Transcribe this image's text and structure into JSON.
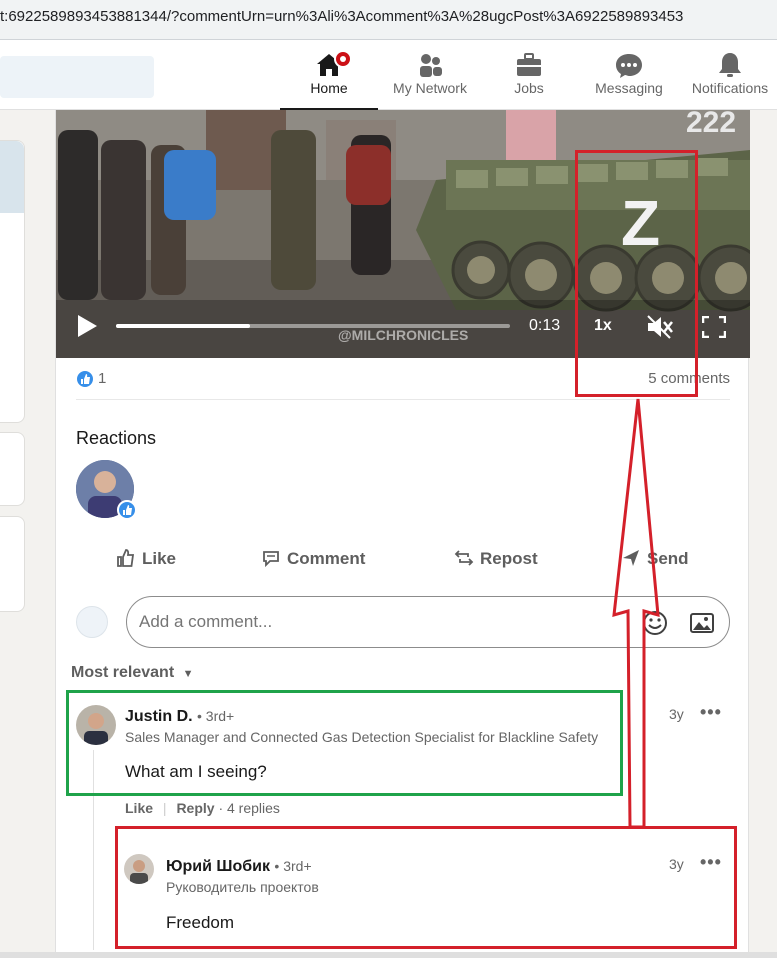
{
  "browser": {
    "url": "t:6922589893453881344/?commentUrn=urn%3Ali%3Acomment%3A%28ugcPost%3A6922589893453"
  },
  "nav": {
    "items": [
      {
        "label": "Home",
        "icon": "home-icon"
      },
      {
        "label": "My Network",
        "icon": "people-icon"
      },
      {
        "label": "Jobs",
        "icon": "briefcase-icon"
      },
      {
        "label": "Messaging",
        "icon": "chat-icon"
      },
      {
        "label": "Notifications",
        "icon": "bell-icon"
      }
    ],
    "active": "Home",
    "colors": {
      "badge": "#cc1016"
    }
  },
  "video": {
    "time": "0:13",
    "speed": "1x",
    "watermark": "@MILCHRONICLES",
    "progress": 0.34,
    "muted": true,
    "tank_marking": "Z",
    "tank_number": "222"
  },
  "post": {
    "like_count": "1",
    "comments_count": "5 comments"
  },
  "reactions": {
    "heading": "Reactions"
  },
  "actions": {
    "like": "Like",
    "comment": "Comment",
    "repost": "Repost",
    "send": "Send"
  },
  "comment_input": {
    "placeholder": "Add a comment..."
  },
  "sort": {
    "label": "Most relevant"
  },
  "comments": [
    {
      "name": "Justin D.",
      "degree": "• 3rd+",
      "title": "Sales Manager and Connected Gas Detection Specialist for Blackline Safety",
      "time": "3y",
      "text": "What am I seeing?",
      "like": "Like",
      "reply": "Reply",
      "replies": "· 4 replies"
    },
    {
      "name": "Юрий Шобик",
      "degree": "• 3rd+",
      "title": "Руководитель проектов",
      "time": "3y",
      "text": "Freedom"
    }
  ],
  "annotation_colors": {
    "red": "#d4202a",
    "green": "#1fa34a"
  }
}
